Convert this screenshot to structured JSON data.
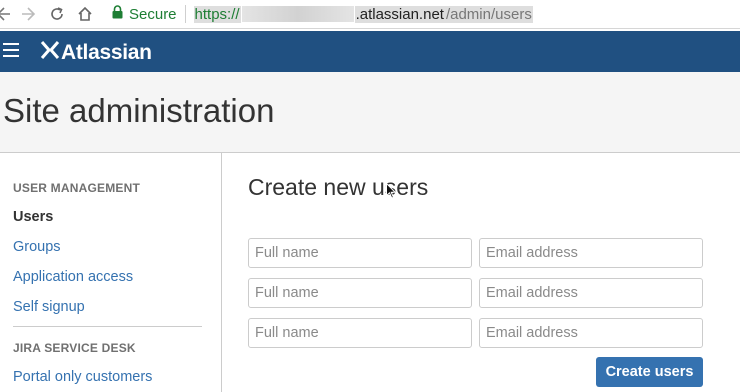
{
  "browser": {
    "secure_label": "Secure",
    "url_scheme": "https://",
    "url_host": ".atlassian.net",
    "url_path": "/admin/users"
  },
  "topbar": {
    "logo_text": "Atlassian",
    "brand_color": "#205081"
  },
  "page": {
    "title": "Site administration"
  },
  "sidebar": {
    "sections": [
      {
        "heading": "USER MANAGEMENT",
        "items": [
          {
            "label": "Users",
            "active": true
          },
          {
            "label": "Groups"
          },
          {
            "label": "Application access"
          },
          {
            "label": "Self signup"
          }
        ]
      },
      {
        "heading": "JIRA SERVICE DESK",
        "items": [
          {
            "label": "Portal only customers"
          }
        ]
      }
    ]
  },
  "main": {
    "title": "Create new users",
    "rows": [
      {
        "name_placeholder": "Full name",
        "email_placeholder": "Email address"
      },
      {
        "name_placeholder": "Full name",
        "email_placeholder": "Email address"
      },
      {
        "name_placeholder": "Full name",
        "email_placeholder": "Email address"
      }
    ],
    "submit_label": "Create users",
    "accent_color": "#3572b0"
  }
}
